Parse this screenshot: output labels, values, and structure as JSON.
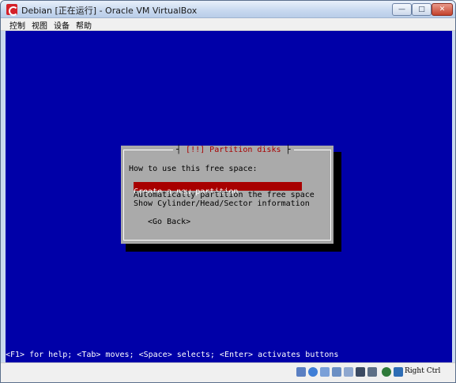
{
  "window": {
    "title": "Debian [正在运行] - Oracle VM VirtualBox",
    "minimize": "—",
    "maximize": "□",
    "close": "✕"
  },
  "menu": [
    "控制",
    "视图",
    "设备",
    "帮助"
  ],
  "installer": {
    "dialog_title_marker": "[!!]",
    "dialog_title": "Partition disks",
    "prompt": "How to use this free space:",
    "options": [
      "Create a new partition",
      "Automatically partition the free space",
      "Show Cylinder/Head/Sector information"
    ],
    "selected_index": 0,
    "go_back": "<Go Back>",
    "help_line": "<F1> for help; <Tab> moves; <Space> selects; <Enter> activates buttons"
  },
  "statusbar": {
    "icons": [
      "hard-disk-icon",
      "optical-drive-icon",
      "usb-icon",
      "shared-folders-icon",
      "network-icon",
      "display-icon",
      "video-capture-icon",
      "virtualization-icon",
      "mouse-integration-icon"
    ],
    "host_key": "Right Ctrl"
  },
  "colors": {
    "screen_bg": "#0000a8",
    "dialog_bg": "#aaaaaa",
    "highlight": "#a80000"
  }
}
